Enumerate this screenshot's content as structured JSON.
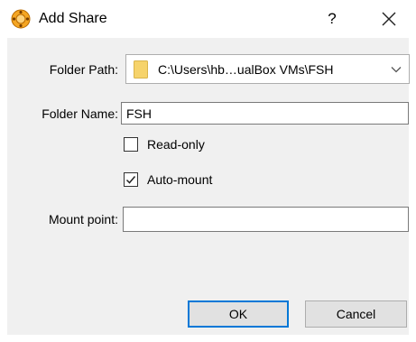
{
  "window": {
    "title": "Add Share",
    "help_label": "?",
    "app_icon": "virtualbox-icon",
    "close_icon": "close-icon"
  },
  "form": {
    "folder_path_label": "Folder Path:",
    "folder_path_value": "C:\\Users\\hb…ualBox VMs\\FSH",
    "folder_name_label": "Folder Name:",
    "folder_name_value": "FSH",
    "readonly_label": "Read-only",
    "readonly_checked": false,
    "automount_label": "Auto-mount",
    "automount_checked": true,
    "mount_point_label": "Mount point:",
    "mount_point_value": ""
  },
  "buttons": {
    "ok": "OK",
    "cancel": "Cancel"
  },
  "colors": {
    "accent": "#0078d7",
    "dialog_bg": "#f0f0f0",
    "folder_icon": "#f6d36b"
  }
}
